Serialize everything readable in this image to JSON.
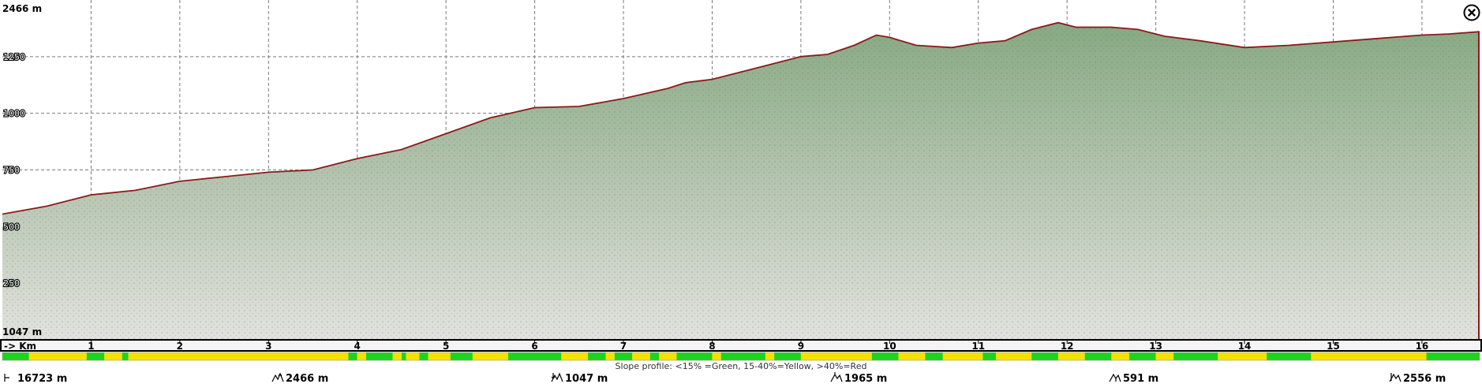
{
  "chart_data": {
    "type": "area",
    "y_top_label": "2466 m",
    "y_bottom_label": "1047 m",
    "y_ticks": [
      250,
      500,
      750,
      1000,
      1250
    ],
    "ylim": [
      0,
      1500
    ],
    "x_axis_label": "-> Km",
    "x_ticks": [
      1,
      2,
      3,
      4,
      5,
      6,
      7,
      8,
      9,
      10,
      11,
      12,
      13,
      14,
      15,
      16
    ],
    "xlim": [
      0,
      16.65
    ],
    "grid": true,
    "series": [
      {
        "x": [
          0,
          0.5,
          1,
          1.5,
          2,
          2.5,
          3,
          3.5,
          4,
          4.5,
          5,
          5.5,
          6,
          6.5,
          7,
          7.5,
          7.7,
          8,
          8.5,
          9,
          9.3,
          9.6,
          9.85,
          10,
          10.3,
          10.7,
          11,
          11.3,
          11.6,
          11.9,
          12.1,
          12.5,
          12.8,
          13.1,
          13.5,
          14,
          14.5,
          15,
          15.5,
          16,
          16.3,
          16.65
        ],
        "values": [
          555,
          590,
          640,
          660,
          700,
          720,
          740,
          750,
          800,
          840,
          910,
          980,
          1025,
          1030,
          1065,
          1110,
          1135,
          1150,
          1200,
          1250,
          1260,
          1300,
          1345,
          1335,
          1300,
          1290,
          1310,
          1320,
          1370,
          1400,
          1380,
          1380,
          1370,
          1340,
          1320,
          1290,
          1300,
          1315,
          1330,
          1345,
          1350,
          1360
        ]
      }
    ],
    "slope_profile": {
      "legend": "Slope profile: <15% =Green, 15-40%=Yellow, >40%=Red",
      "colors": {
        "green": "#1fd21f",
        "yellow": "#f5e100"
      },
      "segments": [
        [
          0,
          0.3,
          "green"
        ],
        [
          0.3,
          0.95,
          "yellow"
        ],
        [
          0.95,
          1.15,
          "green"
        ],
        [
          1.15,
          1.35,
          "yellow"
        ],
        [
          1.35,
          1.42,
          "green"
        ],
        [
          1.42,
          3.9,
          "yellow"
        ],
        [
          3.9,
          4.0,
          "green"
        ],
        [
          4.0,
          4.1,
          "yellow"
        ],
        [
          4.1,
          4.4,
          "green"
        ],
        [
          4.4,
          4.5,
          "yellow"
        ],
        [
          4.5,
          4.55,
          "green"
        ],
        [
          4.55,
          4.7,
          "yellow"
        ],
        [
          4.7,
          4.8,
          "green"
        ],
        [
          4.8,
          5.05,
          "yellow"
        ],
        [
          5.05,
          5.3,
          "green"
        ],
        [
          5.3,
          5.7,
          "yellow"
        ],
        [
          5.7,
          6.3,
          "green"
        ],
        [
          6.3,
          6.6,
          "yellow"
        ],
        [
          6.6,
          6.8,
          "green"
        ],
        [
          6.8,
          6.9,
          "yellow"
        ],
        [
          6.9,
          7.1,
          "green"
        ],
        [
          7.1,
          7.3,
          "yellow"
        ],
        [
          7.3,
          7.4,
          "green"
        ],
        [
          7.4,
          7.6,
          "yellow"
        ],
        [
          7.6,
          8.0,
          "green"
        ],
        [
          8.0,
          8.1,
          "yellow"
        ],
        [
          8.1,
          8.6,
          "green"
        ],
        [
          8.6,
          8.7,
          "yellow"
        ],
        [
          8.7,
          9.0,
          "green"
        ],
        [
          9.0,
          9.8,
          "yellow"
        ],
        [
          9.8,
          10.1,
          "green"
        ],
        [
          10.1,
          10.4,
          "yellow"
        ],
        [
          10.4,
          10.6,
          "green"
        ],
        [
          10.6,
          11.05,
          "yellow"
        ],
        [
          11.05,
          11.2,
          "green"
        ],
        [
          11.2,
          11.6,
          "yellow"
        ],
        [
          11.6,
          11.9,
          "green"
        ],
        [
          11.9,
          12.2,
          "yellow"
        ],
        [
          12.2,
          12.5,
          "green"
        ],
        [
          12.5,
          12.7,
          "yellow"
        ],
        [
          12.7,
          13.0,
          "green"
        ],
        [
          13.0,
          13.2,
          "yellow"
        ],
        [
          13.2,
          13.7,
          "green"
        ],
        [
          13.7,
          14.25,
          "yellow"
        ],
        [
          14.25,
          14.75,
          "green"
        ],
        [
          14.75,
          16.05,
          "yellow"
        ],
        [
          16.05,
          16.65,
          "green"
        ]
      ]
    },
    "stats": [
      {
        "icon": "distance-icon",
        "value": "16723 m"
      },
      {
        "icon": "total-ascent-icon",
        "value": "2466 m"
      },
      {
        "icon": "total-descent-icon",
        "value": "1047 m"
      },
      {
        "icon": "max-elevation-icon",
        "value": "1965 m"
      },
      {
        "icon": "min-elevation-icon",
        "value": "591 m"
      },
      {
        "icon": "elevation-range-icon",
        "value": "2556 m"
      }
    ],
    "colors": {
      "profile_line": "#8b1a1a",
      "fill_top": "#8fb08c",
      "fill_bottom": "#dcdcd6",
      "axis": "#000000",
      "grid": "#7a7a7a",
      "current_marker": "#8b1a1a"
    }
  },
  "close_button": {
    "icon": "close-icon"
  }
}
